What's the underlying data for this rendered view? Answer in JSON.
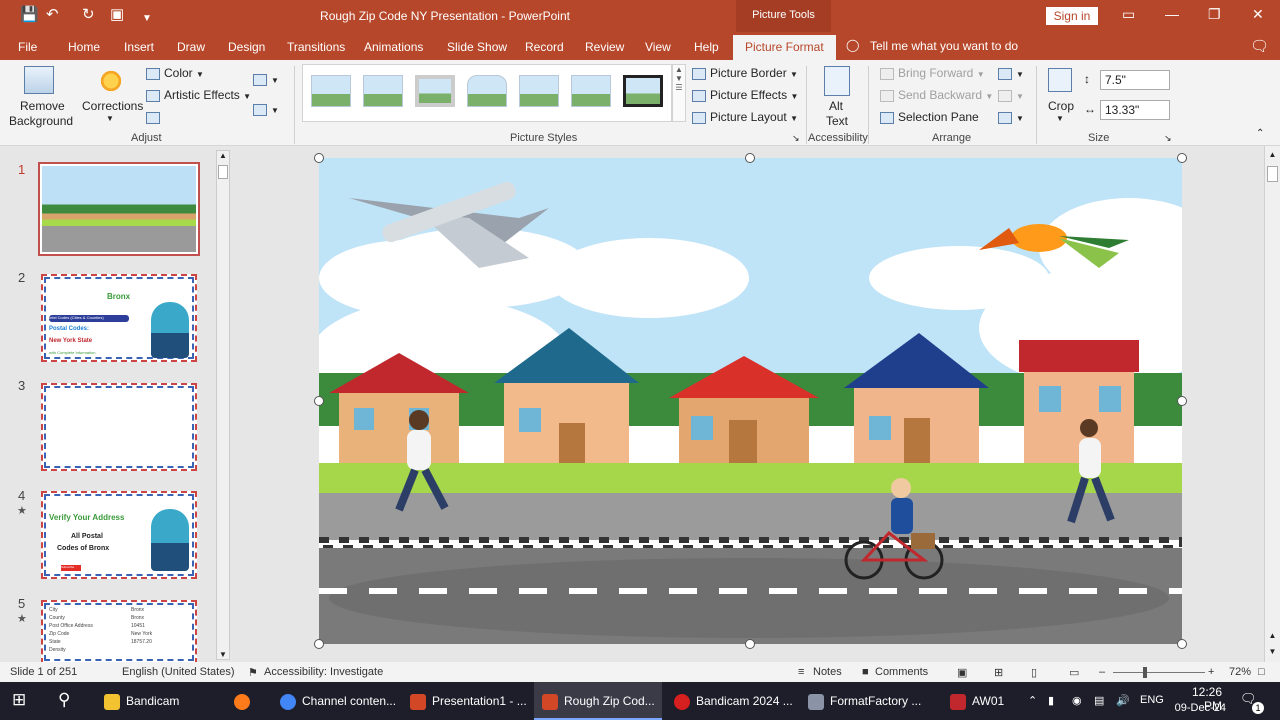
{
  "titlebar": {
    "doc_title": "Rough Zip Code NY Presentation  -  PowerPoint",
    "context_tab": "Picture Tools",
    "signin": "Sign in"
  },
  "tabs": [
    "File",
    "Home",
    "Insert",
    "Draw",
    "Design",
    "Transitions",
    "Animations",
    "Slide Show",
    "Record",
    "Review",
    "View",
    "Help"
  ],
  "active_tab": "Picture Format",
  "tellme": "Tell me what you want to do",
  "ribbon": {
    "adjust": {
      "remove_bg_1": "Remove",
      "remove_bg_2": "Background",
      "corrections": "Corrections",
      "color": "Color",
      "artistic": "Artistic Effects",
      "label": "Adjust"
    },
    "styles": {
      "label": "Picture Styles",
      "border": "Picture Border",
      "effects": "Picture Effects",
      "layout": "Picture Layout"
    },
    "accessibility": {
      "alt1": "Alt",
      "alt2": "Text",
      "label": "Accessibility"
    },
    "arrange": {
      "forward": "Bring Forward",
      "backward": "Send Backward",
      "pane": "Selection Pane",
      "label": "Arrange"
    },
    "size": {
      "crop": "Crop",
      "height": "7.5\"",
      "width": "13.33\"",
      "label": "Size"
    }
  },
  "slides": [
    {
      "num": "1",
      "star": ""
    },
    {
      "num": "2",
      "star": "",
      "text_a": "Bronx",
      "text_b": "Intel Codes (Cities & Counties)",
      "text_c": "Postal Codes:",
      "text_d": "New York State",
      "text_e": "with Complete Information"
    },
    {
      "num": "3",
      "star": ""
    },
    {
      "num": "4",
      "star": "★",
      "text_a": "Verify Your Address",
      "text_b": "All Postal",
      "text_c": "Codes of Bronx",
      "text_d": "Subscribe"
    },
    {
      "num": "5",
      "star": "★",
      "rows": [
        "City",
        "County",
        "Post Office Address",
        "Zip Code",
        "State",
        "Density"
      ],
      "vals": [
        "Bronx",
        "Bronx",
        "10451",
        "New York",
        "18757.20"
      ]
    }
  ],
  "status": {
    "slide": "Slide 1 of 251",
    "lang": "English (United States)",
    "access": "Accessibility: Investigate",
    "notes": "Notes",
    "comments": "Comments",
    "zoom": "72%"
  },
  "taskbar": {
    "apps": [
      "Bandicam",
      "Channel conten...",
      "Presentation1 - ...",
      "Rough Zip Cod...",
      "Bandicam 2024 ...",
      "FormatFactory ...",
      "AW01"
    ],
    "lang": "ENG",
    "time": "12:26 PM",
    "date": "09-Dec-24",
    "notif": "1"
  },
  "colors": {
    "accent": "#b7472a",
    "taskbar": "#1e1e2a"
  }
}
